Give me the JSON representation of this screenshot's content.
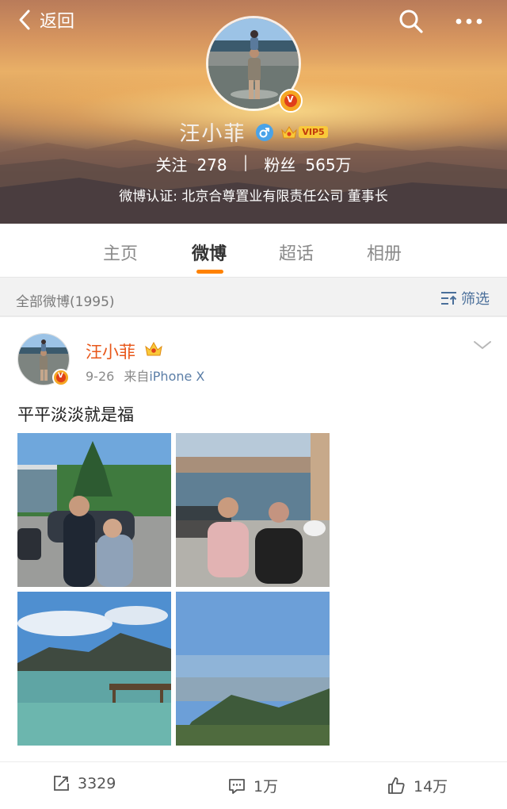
{
  "header": {
    "back_label": "返回",
    "profile_name": "汪小菲",
    "vip_label": "VIP5",
    "stats": {
      "follow_label": "关注",
      "follow_count": "278",
      "fans_label": "粉丝",
      "fans_count": "565万"
    },
    "certification": "微博认证: 北京合尊置业有限责任公司 董事长"
  },
  "tabs": [
    {
      "label": "主页",
      "active": false
    },
    {
      "label": "微博",
      "active": true
    },
    {
      "label": "超话",
      "active": false
    },
    {
      "label": "相册",
      "active": false
    }
  ],
  "filter_bar": {
    "all_posts": "全部微博(1995)",
    "filter_label": "筛选"
  },
  "post": {
    "username": "汪小菲",
    "date": "9-26",
    "source_prefix": "来自",
    "device": "iPhone X",
    "text": "平平淡淡就是福"
  },
  "actions": {
    "repost_count": "3329",
    "comment_count": "1万",
    "like_count": "14万"
  },
  "colors": {
    "accent": "#ff8200",
    "username": "#e8571a",
    "link": "#5b7ea7"
  }
}
